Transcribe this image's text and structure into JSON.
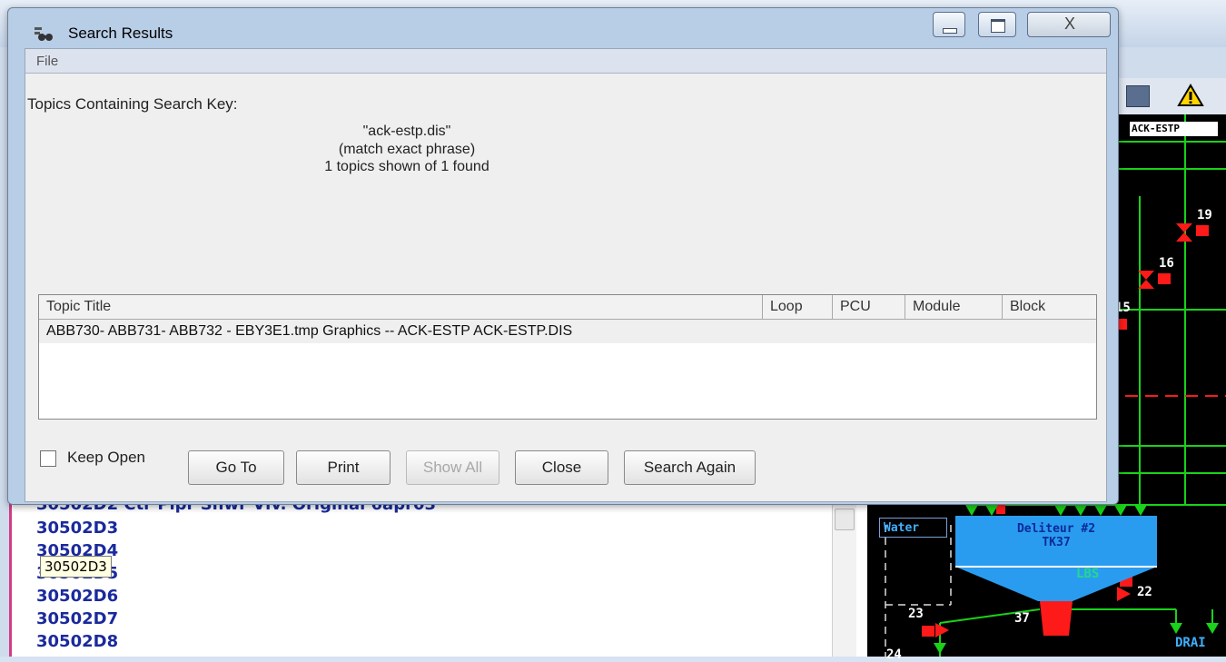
{
  "dialog": {
    "title": "Search Results",
    "close_glyph": "X",
    "menu": {
      "file": "File"
    },
    "topics_label": "Topics Containing Search Key:",
    "search_key": "\"ack-estp.dis\"",
    "match_mode": "(match exact phrase)",
    "count_text": "1 topics shown of 1 found",
    "columns": [
      "Topic Title",
      "Loop",
      "PCU",
      "Module",
      "Block"
    ],
    "rows": [
      "ABB730- ABB731- ABB732 - EBY3E1.tmp Graphics -- ACK-ESTP ACK-ESTP.DIS"
    ],
    "keep_open_label": "Keep Open",
    "keep_open_checked": false,
    "buttons": {
      "goto": "Go To",
      "print": "Print",
      "show_all": "Show All",
      "close": "Close",
      "search_again": "Search Again"
    }
  },
  "background": {
    "list_items": [
      "30502D2 Ctr Pipr Shwr Vlv. Original 6apr03",
      "30502D3",
      "30502D4",
      "30502D5",
      "30502D6",
      "30502D7",
      "30502D8"
    ],
    "tooltip": "30502D3",
    "scada": {
      "title": "ACK-ESTP",
      "labels": {
        "n19": "19",
        "n16": "16",
        "n15": "15",
        "water": "Water",
        "tank_name": "Deliteur #2",
        "tank_id": "TK37",
        "lbs": "LBS",
        "n22": "22",
        "n23": "23",
        "n37": "37",
        "n24": "24",
        "drain": "DRAI"
      }
    },
    "toolbar_icons": [
      "display-icon",
      "warning-icon"
    ]
  },
  "colors": {
    "scada_green": "#19d219",
    "scada_red": "#ff1a1a",
    "tank_blue": "#2a9cf0",
    "list_blue": "#1a2a9c",
    "highlight_pink": "#d23c8a"
  }
}
